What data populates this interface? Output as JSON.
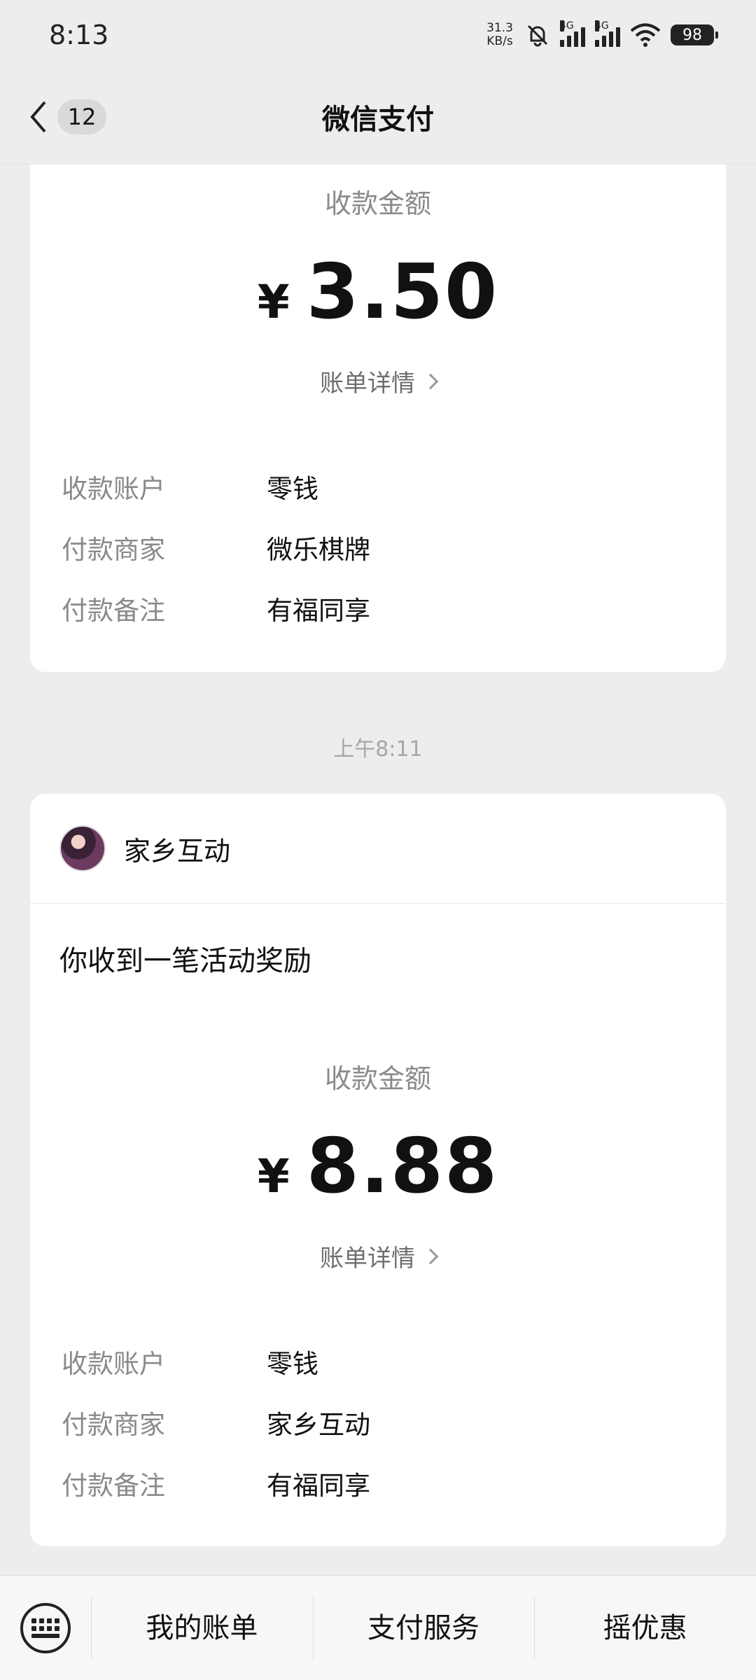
{
  "status": {
    "time": "8:13",
    "net_speed_value": "31.3",
    "net_speed_unit": "KB/s",
    "signal1_tag": "4G",
    "signal2_tag": "4G",
    "battery": "98"
  },
  "nav": {
    "unread_count": "12",
    "title": "微信支付"
  },
  "messages": [
    {
      "amount_label": "收款金额",
      "currency": "¥",
      "amount": "3.50",
      "bill_detail": "账单详情",
      "fields": [
        {
          "key": "收款账户",
          "value": "零钱"
        },
        {
          "key": "付款商家",
          "value": "微乐棋牌"
        },
        {
          "key": "付款备注",
          "value": "有福同享"
        }
      ]
    },
    {
      "timestamp": "上午8:11",
      "merchant": "家乡互动",
      "headline": "你收到一笔活动奖励",
      "amount_label": "收款金额",
      "currency": "¥",
      "amount": "8.88",
      "bill_detail": "账单详情",
      "fields": [
        {
          "key": "收款账户",
          "value": "零钱"
        },
        {
          "key": "付款商家",
          "value": "家乡互动"
        },
        {
          "key": "付款备注",
          "value": "有福同享"
        }
      ]
    }
  ],
  "bottom_menu": {
    "items": [
      "我的账单",
      "支付服务",
      "摇优惠"
    ]
  },
  "colors": {
    "background": "#ededed",
    "card": "#ffffff",
    "secondary_text": "#8a8a8a"
  }
}
